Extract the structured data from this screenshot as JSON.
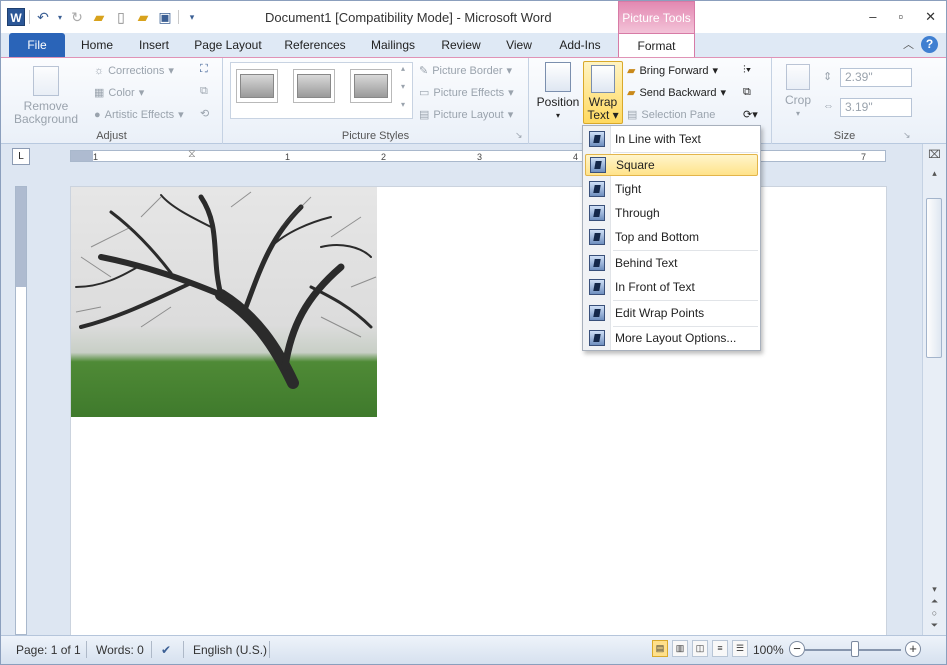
{
  "window": {
    "title": "Document1 [Compatibility Mode] - Microsoft Word",
    "app_logo": "W",
    "contextual_group": "Picture Tools",
    "controls": [
      "minimize-icon",
      "restore-icon",
      "close-icon"
    ]
  },
  "qat": {
    "icons": [
      "word-logo-icon",
      "undo-icon",
      "redo-icon",
      "open-folder-icon",
      "new-document-icon",
      "open-icon",
      "save-icon",
      "customize-qat-icon"
    ]
  },
  "tabs": [
    "File",
    "Home",
    "Insert",
    "Page Layout",
    "References",
    "Mailings",
    "Review",
    "View",
    "Add-Ins",
    "Format"
  ],
  "ribbon": {
    "adjust": {
      "label": "Adjust",
      "remove_bg_line1": "Remove",
      "remove_bg_line2": "Background",
      "corrections": "Corrections",
      "color": "Color",
      "artistic": "Artistic Effects"
    },
    "styles": {
      "label": "Picture Styles",
      "border": "Picture Border",
      "effects": "Picture Effects",
      "layout": "Picture Layout"
    },
    "arrange": {
      "position": "Position",
      "wrap_line1": "Wrap",
      "wrap_line2": "Text",
      "bring_forward": "Bring Forward",
      "send_backward": "Send Backward",
      "selection_pane": "Selection Pane"
    },
    "size": {
      "label": "Size",
      "crop": "Crop",
      "height": "2.39\"",
      "width": "3.19\""
    }
  },
  "ruler": {
    "ticks": [
      "1",
      "1",
      "2",
      "3",
      "4",
      "7"
    ]
  },
  "wrap_menu": {
    "items": [
      "In Line with Text",
      "Square",
      "Tight",
      "Through",
      "Top and Bottom",
      "Behind Text",
      "In Front of Text",
      "Edit Wrap Points",
      "More Layout Options..."
    ],
    "highlighted": "Square"
  },
  "statusbar": {
    "page": "Page: 1 of 1",
    "words": "Words: 0",
    "language": "English (U.S.)",
    "zoom": "100%"
  }
}
